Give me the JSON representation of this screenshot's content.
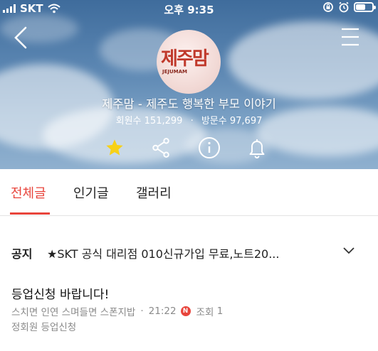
{
  "status_bar": {
    "carrier": "SKT",
    "time": "오후 9:35",
    "battery_level": 0.55
  },
  "header": {
    "logo_text_ko": "제주맘",
    "logo_text_en": "JEJUMAM",
    "cafe_name": "제주맘 - 제주도 행복한 부모 이야기",
    "members_label": "회원수",
    "members_count": "151,299",
    "visits_label": "방문수",
    "visits_count": "97,697"
  },
  "actions": {
    "favorite_icon": "star-icon",
    "share_icon": "share-icon",
    "info_icon": "info-icon",
    "notification_icon": "bell-icon",
    "favorite_color": "#f7d117"
  },
  "tabs": [
    {
      "label": "전체글",
      "active": true
    },
    {
      "label": "인기글",
      "active": false
    },
    {
      "label": "갤러리",
      "active": false
    }
  ],
  "notice": {
    "label": "공지",
    "text": "★SKT 공식 대리점 010신규가입 무료,노트20..."
  },
  "post": {
    "title": "등업신청 바랍니다!",
    "author": "스치면 인연 스며들면 스폰지밥",
    "time": "21:22",
    "new_badge": "N",
    "views_label": "조회",
    "views": "1",
    "board": "정회원 등업신청"
  },
  "colors": {
    "accent": "#e8453c",
    "meta_text": "#8a8a8a"
  }
}
